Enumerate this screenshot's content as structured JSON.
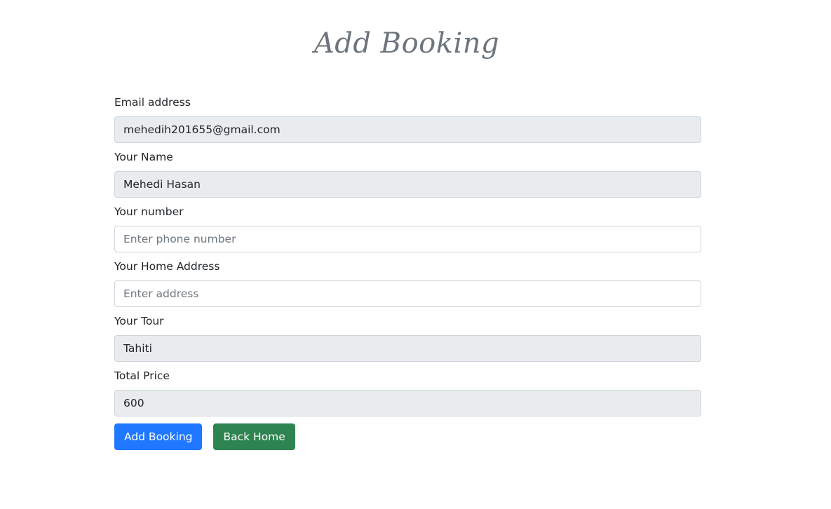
{
  "page": {
    "title": "Add Booking"
  },
  "form": {
    "email": {
      "label": "Email address",
      "value": "mehedih201655@gmail.com"
    },
    "name": {
      "label": "Your Name",
      "value": "Mehedi Hasan"
    },
    "phone": {
      "label": "Your number",
      "value": "",
      "placeholder": "Enter phone number"
    },
    "address": {
      "label": "Your Home Address",
      "value": "",
      "placeholder": "Enter address"
    },
    "tour": {
      "label": "Your Tour",
      "value": "Tahiti"
    },
    "price": {
      "label": "Total Price",
      "value": "600"
    }
  },
  "buttons": {
    "add_booking": "Add Booking",
    "back_home": "Back Home"
  },
  "colors": {
    "primary": "#1f78ff",
    "success": "#2e8450",
    "title": "#6c757d",
    "readonly_bg": "#e9ecef"
  }
}
